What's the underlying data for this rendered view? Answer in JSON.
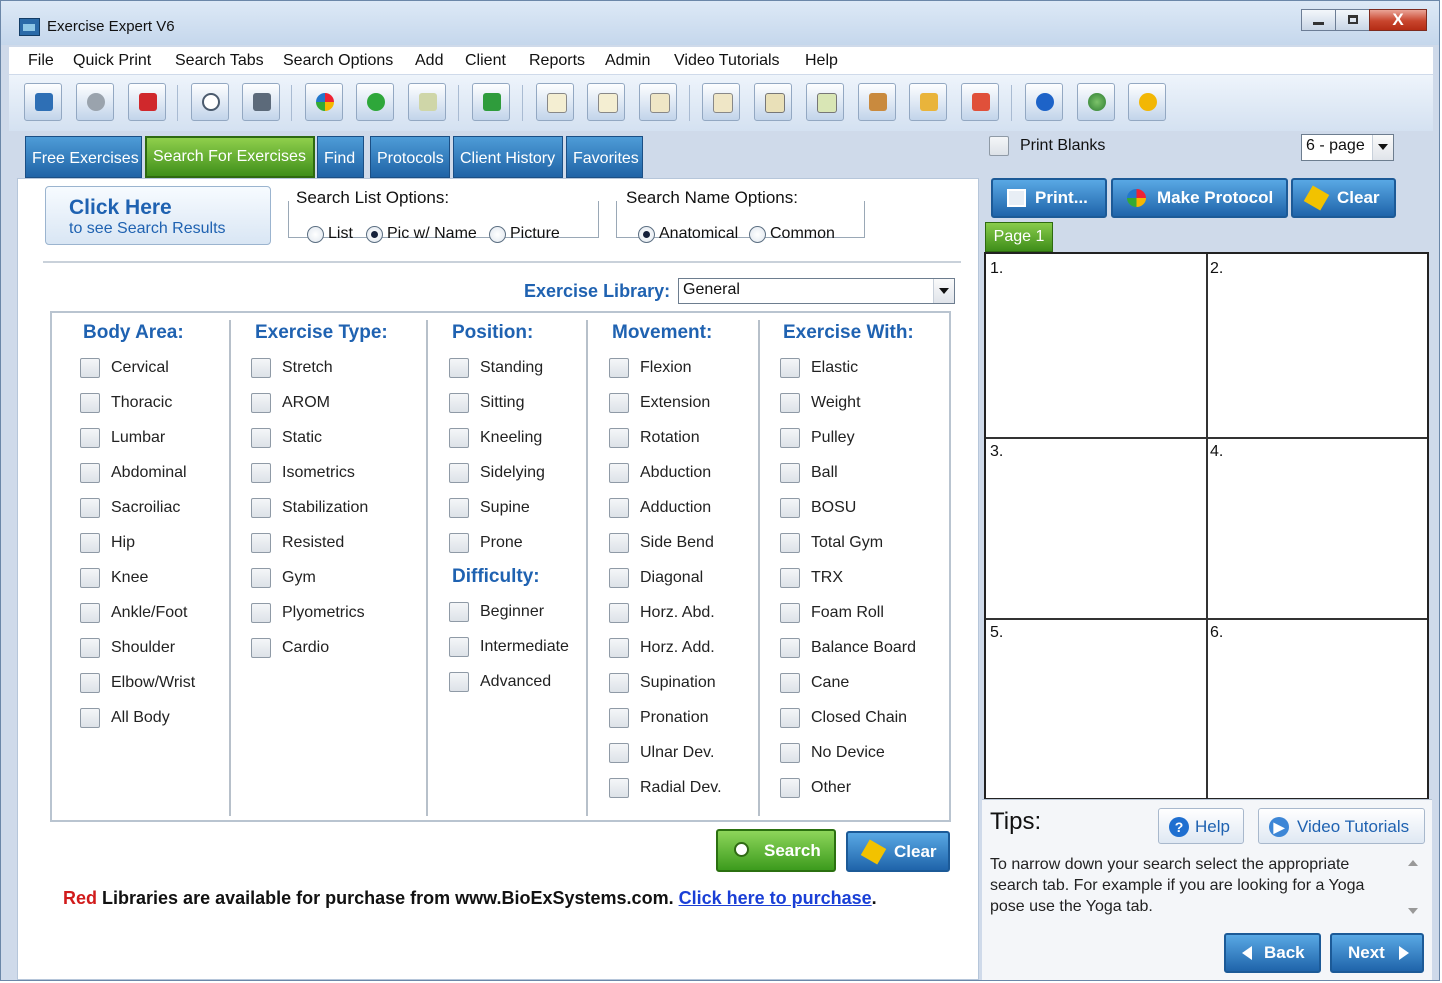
{
  "window": {
    "title": "Exercise Expert V6",
    "close_glyph": "X"
  },
  "menu": [
    "File",
    "Quick Print",
    "Search Tabs",
    "Search Options",
    "Add",
    "Client",
    "Reports",
    "Admin",
    "Video Tutorials",
    "Help"
  ],
  "toolbar_icons": [
    "monitor-icon",
    "gear-icon",
    "pdf-icon",
    "search-icon",
    "printer-icon",
    "protocol-icon",
    "add-icon",
    "add-card-icon",
    "undo-icon",
    "page-icon",
    "pages-icon",
    "clipboard-icon",
    "notes-icon",
    "book-icon",
    "table-icon",
    "library-icon",
    "import-icon",
    "export-icon",
    "help-icon",
    "globe-icon",
    "warning-icon"
  ],
  "tabs": [
    "Free Exercises",
    "Search For Exercises",
    "Find",
    "Protocols",
    "Client History",
    "Favorites"
  ],
  "click_here": {
    "title": "Click Here",
    "subtitle": "to see Search Results"
  },
  "search_list_options": {
    "label": "Search List Options:",
    "options": [
      "List",
      "Pic w/ Name",
      "Picture"
    ],
    "selected": "Pic w/ Name"
  },
  "search_name_options": {
    "label": "Search Name Options:",
    "options": [
      "Anatomical",
      "Common"
    ],
    "selected": "Anatomical"
  },
  "exercise_library": {
    "label": "Exercise Library:",
    "value": "General"
  },
  "columns": {
    "body_area": {
      "title": "Body Area:",
      "items": [
        "Cervical",
        "Thoracic",
        "Lumbar",
        "Abdominal",
        "Sacroiliac",
        "Hip",
        "Knee",
        "Ankle/Foot",
        "Shoulder",
        "Elbow/Wrist",
        "All Body"
      ]
    },
    "exercise_type": {
      "title": "Exercise Type:",
      "items": [
        "Stretch",
        "AROM",
        "Static",
        "Isometrics",
        "Stabilization",
        "Resisted",
        "Gym",
        "Plyometrics",
        "Cardio"
      ]
    },
    "position": {
      "title": "Position:",
      "items": [
        "Standing",
        "Sitting",
        "Kneeling",
        "Sidelying",
        "Supine",
        "Prone"
      ]
    },
    "difficulty": {
      "title": "Difficulty:",
      "items": [
        "Beginner",
        "Intermediate",
        "Advanced"
      ]
    },
    "movement": {
      "title": "Movement:",
      "items": [
        "Flexion",
        "Extension",
        "Rotation",
        "Abduction",
        "Adduction",
        "Side Bend",
        "Diagonal",
        "Horz. Abd.",
        "Horz. Add.",
        "Supination",
        "Pronation",
        "Ulnar Dev.",
        "Radial Dev."
      ]
    },
    "exercise_with": {
      "title": "Exercise With:",
      "items": [
        "Elastic",
        "Weight",
        "Pulley",
        "Ball",
        "BOSU",
        "Total Gym",
        "TRX",
        "Foam Roll",
        "Balance Board",
        "Cane",
        "Closed Chain",
        "No Device",
        "Other"
      ]
    }
  },
  "buttons": {
    "search": "Search",
    "clear": "Clear"
  },
  "purchase": {
    "red": "Red",
    "text": " Libraries are available for purchase from www.BioExSystems.com. ",
    "link": "Click here to purchase",
    "end": "."
  },
  "right": {
    "print_blanks": "Print Blanks",
    "page_layout": "6 - page",
    "print_button": "Print...",
    "make_protocol_button": "Make Protocol",
    "clear_button": "Clear",
    "page_tab": "Page 1",
    "cells": [
      "1.",
      "2.",
      "3.",
      "4.",
      "5.",
      "6."
    ]
  },
  "tips": {
    "title": "Tips:",
    "help_button": "Help",
    "video_button": "Video Tutorials",
    "text": "To narrow down your search select the appropriate search tab.  For example if you are looking for a Yoga pose use the Yoga tab.",
    "back_button": "Back",
    "next_button": "Next"
  },
  "colors": {
    "accent_blue": "#1f62b1",
    "active_tab_green": "#3f8f1a",
    "tab_blue": "#1f63a6",
    "red": "#d11b1b"
  }
}
